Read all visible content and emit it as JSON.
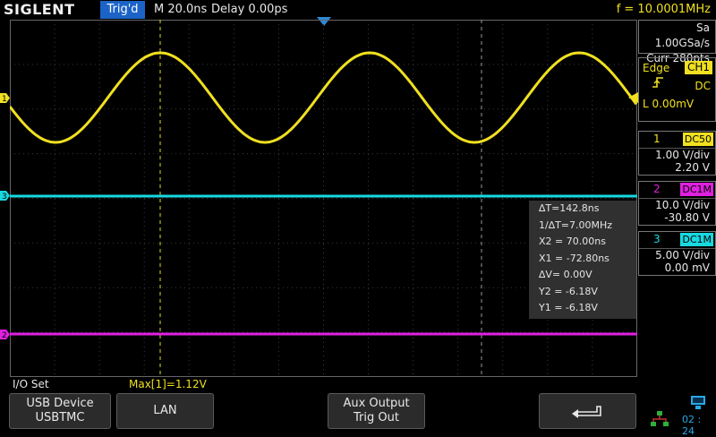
{
  "topbar": {
    "brand": "SIGLENT",
    "trigger_status": "Trig'd",
    "timebase": "M 20.0ns",
    "delay": "Delay 0.00ps",
    "frequency": "f = 10.0001MHz"
  },
  "acquisition": {
    "sample_rate": "Sa 1.00GSa/s",
    "memory": "Curr 280pts"
  },
  "trigger": {
    "type": "Edge",
    "source": "CH1",
    "coupling": "DC",
    "level": "L  0.00mV",
    "color": "#f0e020"
  },
  "channels": [
    {
      "num": "1",
      "coupling": "DC50",
      "scale": "1.00 V/div",
      "offset": "2.20 V",
      "color": "#f0e020"
    },
    {
      "num": "2",
      "coupling": "DC1M",
      "scale": "10.0 V/div",
      "offset": "-30.80 V",
      "color": "#e020e0"
    },
    {
      "num": "3",
      "coupling": "DC1M",
      "scale": "5.00 V/div",
      "offset": "0.00 mV",
      "color": "#18d8e0"
    }
  ],
  "cursor_readout": {
    "delta_t": "∆T=142.8ns",
    "inv_delta_t": "1/∆T=7.00MHz",
    "x2": "X2 = 70.00ns",
    "x1": "X1 = -72.80ns",
    "delta_v": "∆V= 0.00V",
    "y2": "Y2 = -6.18V",
    "y1": "Y1 = -6.18V"
  },
  "menu": {
    "title": "I/O Set",
    "measurement": "Max[1]=1.12V",
    "softkeys": {
      "usb_device_line1": "USB Device",
      "usb_device_line2": "USBTMC",
      "lan": "LAN",
      "aux_output_line1": "Aux Output",
      "aux_output_line2": "Trig Out"
    }
  },
  "status": {
    "clock": "02 : 24"
  },
  "icons": {
    "back": "return-arrow-icon",
    "usb": "usb-icon",
    "lan": "lan-network-icon"
  }
}
